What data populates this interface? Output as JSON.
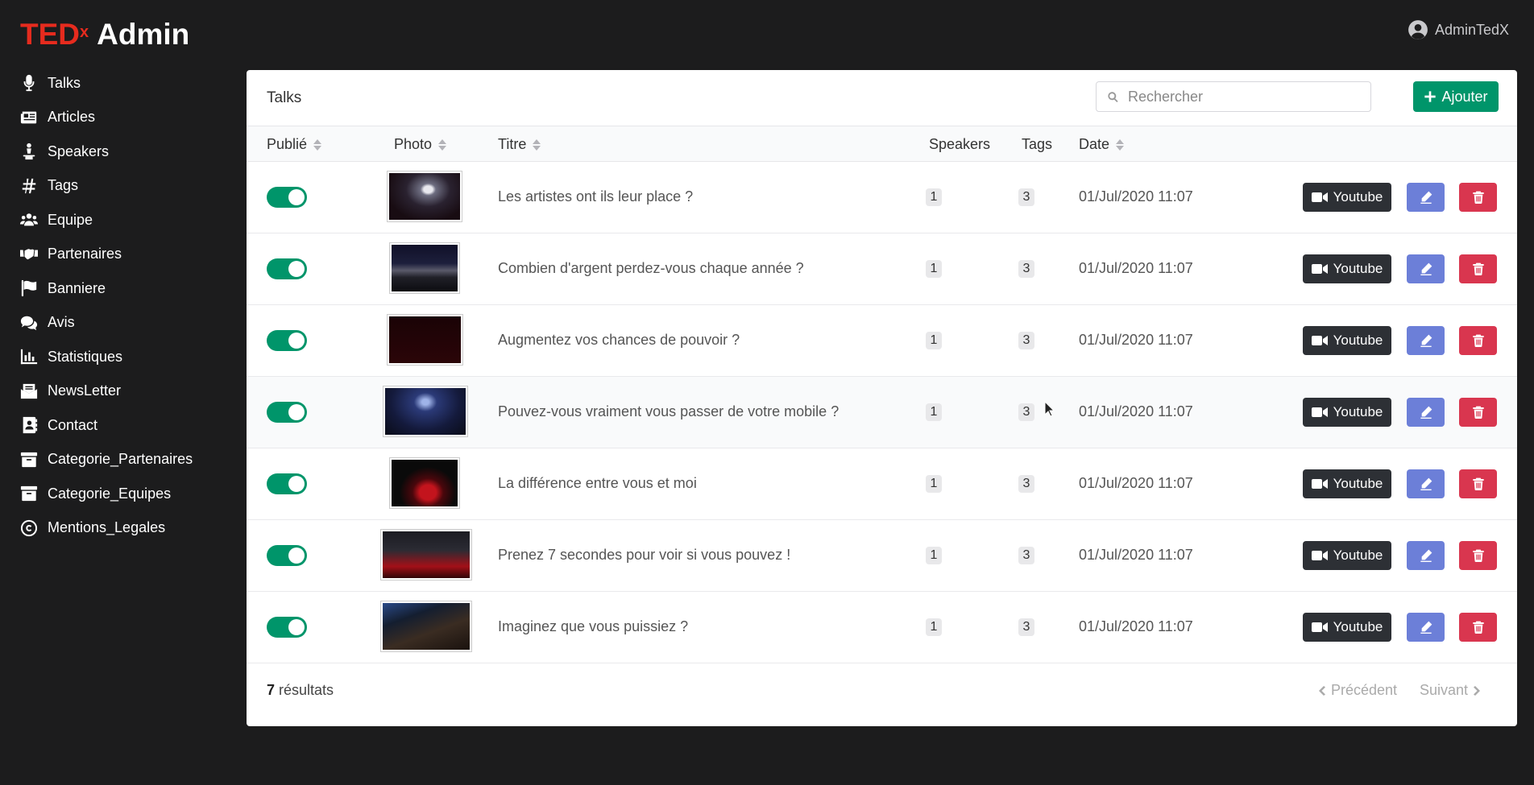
{
  "brand": {
    "ted": "TED",
    "x": "x",
    "admin": "Admin"
  },
  "user": {
    "name": "AdminTedX",
    "icon": "user-circle-icon"
  },
  "sidebar": {
    "items": [
      {
        "label": "Talks",
        "icon": "microphone-icon"
      },
      {
        "label": "Articles",
        "icon": "newspaper-icon"
      },
      {
        "label": "Speakers",
        "icon": "speaker-person-icon"
      },
      {
        "label": "Tags",
        "icon": "hashtag-icon"
      },
      {
        "label": "Equipe",
        "icon": "users-icon"
      },
      {
        "label": "Partenaires",
        "icon": "handshake-icon"
      },
      {
        "label": "Banniere",
        "icon": "flag-icon"
      },
      {
        "label": "Avis",
        "icon": "comments-icon"
      },
      {
        "label": "Statistiques",
        "icon": "bar-chart-icon"
      },
      {
        "label": "NewsLetter",
        "icon": "mail-bulk-icon"
      },
      {
        "label": "Contact",
        "icon": "address-book-icon"
      },
      {
        "label": "Categorie_Partenaires",
        "icon": "archive-icon"
      },
      {
        "label": "Categorie_Equipes",
        "icon": "archive-icon"
      },
      {
        "label": "Mentions_Legales",
        "icon": "copyright-icon"
      }
    ]
  },
  "card": {
    "title": "Talks",
    "search_placeholder": "Rechercher",
    "add_label": "Ajouter"
  },
  "table": {
    "columns": {
      "published": "Publié",
      "photo": "Photo",
      "title": "Titre",
      "speakers": "Speakers",
      "tags": "Tags",
      "date": "Date"
    },
    "rows": [
      {
        "published": true,
        "title": "Les artistes ont ils leur place ?",
        "speakers": "1",
        "tags": "3",
        "date": "01/Jul/2020 11:07",
        "youtube": "Youtube"
      },
      {
        "published": true,
        "title": "Combien d'argent perdez-vous chaque année ?",
        "speakers": "1",
        "tags": "3",
        "date": "01/Jul/2020 11:07",
        "youtube": "Youtube"
      },
      {
        "published": true,
        "title": "Augmentez vos chances de pouvoir ?",
        "speakers": "1",
        "tags": "3",
        "date": "01/Jul/2020 11:07",
        "youtube": "Youtube"
      },
      {
        "published": true,
        "title": "Pouvez-vous vraiment vous passer de votre mobile ?",
        "speakers": "1",
        "tags": "3",
        "date": "01/Jul/2020 11:07",
        "youtube": "Youtube"
      },
      {
        "published": true,
        "title": "La différence entre vous et moi",
        "speakers": "1",
        "tags": "3",
        "date": "01/Jul/2020 11:07",
        "youtube": "Youtube"
      },
      {
        "published": true,
        "title": "Prenez 7 secondes pour voir si vous pouvez !",
        "speakers": "1",
        "tags": "3",
        "date": "01/Jul/2020 11:07",
        "youtube": "Youtube"
      },
      {
        "published": true,
        "title": "Imaginez que vous puissiez ?",
        "speakers": "1",
        "tags": "3",
        "date": "01/Jul/2020 11:07",
        "youtube": "Youtube"
      }
    ]
  },
  "footer": {
    "count": "7",
    "results_label": "résultats",
    "prev": "Précédent",
    "next": "Suivant"
  },
  "colors": {
    "background": "#1c1c1d",
    "brand_red": "#e62b1e",
    "green": "#00956a",
    "dark_button": "#2d3035",
    "edit_button": "#6c7fd8",
    "delete_button": "#d9364f"
  }
}
